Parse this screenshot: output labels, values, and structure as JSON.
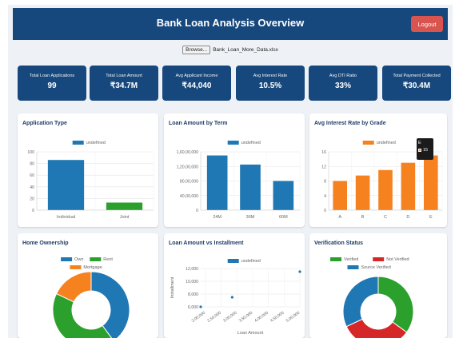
{
  "header": {
    "title": "Bank Loan Analysis Overview",
    "logout_label": "Logout"
  },
  "file": {
    "browse_label": "Browse...",
    "filename": "Bank_Loan_More_Data.xlsx"
  },
  "colors": {
    "header": "#17487d",
    "blue": "#1f77b4",
    "green": "#2ca02c",
    "orange": "#f5821f",
    "red": "#d62728",
    "logout": "#d9534f"
  },
  "kpis": [
    {
      "label": "Total Loan Applications",
      "value": "99"
    },
    {
      "label": "Total Loan Amount",
      "value": "₹34.7M"
    },
    {
      "label": "Avg Applicant Income",
      "value": "₹44,040"
    },
    {
      "label": "Avg Interest Rate",
      "value": "10.5%"
    },
    {
      "label": "Avg DTI Ratio",
      "value": "33%"
    },
    {
      "label": "Total Payment Collected",
      "value": "₹30.4M"
    }
  ],
  "cards": {
    "application_type": {
      "title": "Application Type"
    },
    "loan_by_term": {
      "title": "Loan Amount by Term"
    },
    "rate_by_grade": {
      "title": "Avg Interest Rate by Grade"
    },
    "home_ownership": {
      "title": "Home Ownership"
    },
    "amount_vs_installment": {
      "title": "Loan Amount vs Installment"
    },
    "verification": {
      "title": "Verification Status"
    }
  },
  "tooltip": {
    "title": "E",
    "value": "15",
    "icon": "square-swatch-icon"
  },
  "chart_data": [
    {
      "id": "application_type",
      "type": "bar",
      "categories": [
        "Individual",
        "Joint"
      ],
      "series": [
        {
          "name": "undefined",
          "values": [
            86,
            13
          ],
          "color": "#1f77b4",
          "colors": [
            "#1f77b4",
            "#2ca02c"
          ]
        }
      ],
      "ylim": [
        0,
        100
      ],
      "yticks": [
        "0",
        "20",
        "40",
        "60",
        "80",
        "100"
      ],
      "ytick_values": [
        0,
        20,
        40,
        60,
        80,
        100
      ],
      "legend": "top",
      "grid": true
    },
    {
      "id": "loan_by_term",
      "type": "bar",
      "categories": [
        "24M",
        "36M",
        "60M"
      ],
      "series": [
        {
          "name": "undefined",
          "values": [
            15000000,
            12500000,
            8000000
          ],
          "color": "#1f77b4"
        }
      ],
      "ylim": [
        0,
        16000000
      ],
      "yticks": [
        "0",
        "40,00,000",
        "80,00,000",
        "1,20,00,000",
        "1,60,00,000"
      ],
      "ytick_values": [
        0,
        4000000,
        8000000,
        12000000,
        16000000
      ],
      "legend": "top",
      "grid": true
    },
    {
      "id": "rate_by_grade",
      "type": "bar",
      "categories": [
        "A",
        "B",
        "C",
        "D",
        "E"
      ],
      "series": [
        {
          "name": "undefined",
          "values": [
            8,
            9.5,
            11,
            13,
            15
          ],
          "color": "#f5821f"
        }
      ],
      "ylim": [
        0,
        16
      ],
      "yticks": [
        "0",
        "4",
        "8",
        "12",
        "16"
      ],
      "ytick_values": [
        0,
        4,
        8,
        12,
        16
      ],
      "legend": "top",
      "grid": true
    },
    {
      "id": "home_ownership",
      "type": "pie",
      "donut": true,
      "series": [
        {
          "name": "Own",
          "value": 40,
          "color": "#1f77b4"
        },
        {
          "name": "Rent",
          "value": 42,
          "color": "#2ca02c"
        },
        {
          "name": "Mortgage",
          "value": 18,
          "color": "#f5821f"
        }
      ],
      "legend": "top"
    },
    {
      "id": "amount_vs_installment",
      "type": "scatter",
      "series": [
        {
          "name": "undefined",
          "color": "#1f77b4",
          "x": [
            185000,
            285000,
            500000
          ],
          "y": [
            6000,
            7500,
            11500
          ]
        }
      ],
      "xlabel": "Loan Amount",
      "ylabel": "Installment",
      "xlim": [
        185000,
        500000
      ],
      "ylim": [
        6000,
        12000
      ],
      "xticks": [
        "2,00,000",
        "2,50,000",
        "3,00,000",
        "3,50,000",
        "4,00,000",
        "4,50,000",
        "5,00,000"
      ],
      "xtick_values": [
        200000,
        250000,
        300000,
        350000,
        400000,
        450000,
        500000
      ],
      "yticks": [
        "6,000",
        "8,000",
        "10,000",
        "12,000"
      ],
      "ytick_values": [
        6000,
        8000,
        10000,
        12000
      ],
      "legend": "top",
      "grid": true
    },
    {
      "id": "verification",
      "type": "pie",
      "donut": true,
      "series": [
        {
          "name": "Verified",
          "value": 35,
          "color": "#2ca02c"
        },
        {
          "name": "Not Verified",
          "value": 33,
          "color": "#d62728"
        },
        {
          "name": "Source Verified",
          "value": 32,
          "color": "#1f77b4"
        }
      ],
      "legend": "top"
    }
  ]
}
